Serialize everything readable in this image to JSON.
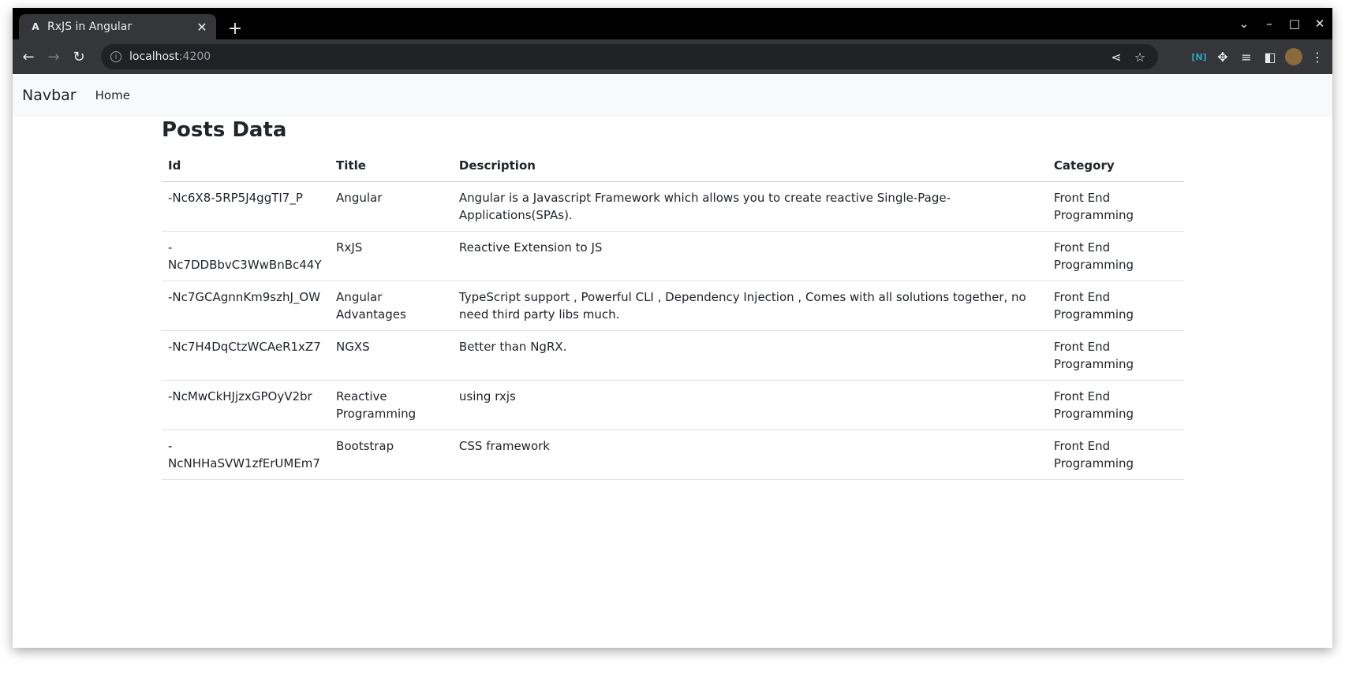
{
  "browser": {
    "tab_title": "RxJS in Angular",
    "tab_favicon": "A",
    "url_host": "localhost",
    "url_port": ":4200"
  },
  "navbar": {
    "brand": "Navbar",
    "links": [
      "Home"
    ]
  },
  "main": {
    "title": "Posts Data",
    "table": {
      "headers": [
        "Id",
        "Title",
        "Description",
        "Category"
      ],
      "rows": [
        {
          "id": "-Nc6X8-5RP5J4ggTI7_P",
          "title": "Angular",
          "description": "Angular is a Javascript Framework which allows you to create reactive Single-Page-Applications(SPAs).",
          "category": "Front End Programming"
        },
        {
          "id": "-Nc7DDBbvC3WwBnBc44Y",
          "title": "RxJS",
          "description": "Reactive Extension to JS",
          "category": "Front End Programming"
        },
        {
          "id": "-Nc7GCAgnnKm9szhJ_OW",
          "title": "Angular Advantages",
          "description": "TypeScript support , Powerful CLI , Dependency Injection , Comes with all solutions together, no need third party libs much.",
          "category": "Front End Programming"
        },
        {
          "id": "-Nc7H4DqCtzWCAeR1xZ7",
          "title": "NGXS",
          "description": "Better than NgRX.",
          "category": "Front End Programming"
        },
        {
          "id": "-NcMwCkHJjzxGPOyV2br",
          "title": "Reactive Programming",
          "description": "using rxjs",
          "category": "Front End Programming"
        },
        {
          "id": "-NcNHHaSVW1zfErUMEm7",
          "title": "Bootstrap",
          "description": "CSS framework",
          "category": "Front End Programming"
        }
      ]
    }
  }
}
